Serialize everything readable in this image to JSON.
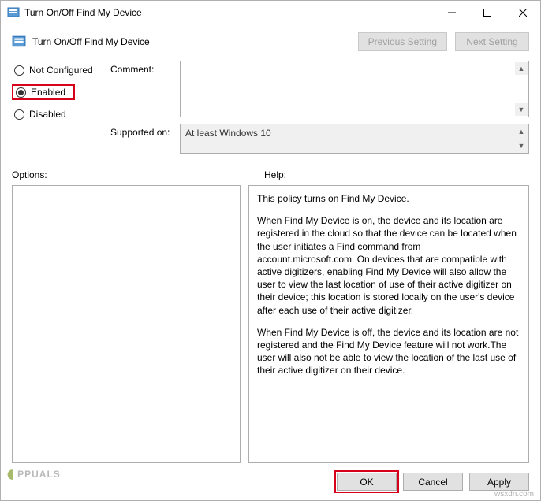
{
  "window": {
    "title": "Turn On/Off Find My Device"
  },
  "subheader": {
    "title": "Turn On/Off Find My Device",
    "prev_label": "Previous Setting",
    "next_label": "Next Setting"
  },
  "radios": {
    "not_configured": "Not Configured",
    "enabled": "Enabled",
    "disabled": "Disabled",
    "selected": "enabled"
  },
  "fields": {
    "comment_label": "Comment:",
    "comment_value": "",
    "supported_label": "Supported on:",
    "supported_value": "At least Windows 10"
  },
  "sections": {
    "options_label": "Options:",
    "help_label": "Help:"
  },
  "help": {
    "p1": "This policy turns on Find My Device.",
    "p2": "When Find My Device is on, the device and its location are registered in the cloud so that the device can be located when the user initiates a Find command from account.microsoft.com. On devices that are compatible with active digitizers, enabling Find My Device will also allow the user to view the last location of use of their active digitizer on their device; this location is stored locally on the user's device after each use of their active digitizer.",
    "p3": "When Find My Device is off, the device and its location are not registered and the Find My Device feature will not work.The user will also not be able to view the location of the last use of their active digitizer on their device."
  },
  "footer": {
    "ok": "OK",
    "cancel": "Cancel",
    "apply": "Apply"
  },
  "watermark": {
    "text": "PPUALS",
    "site": "wsxdn.com"
  }
}
